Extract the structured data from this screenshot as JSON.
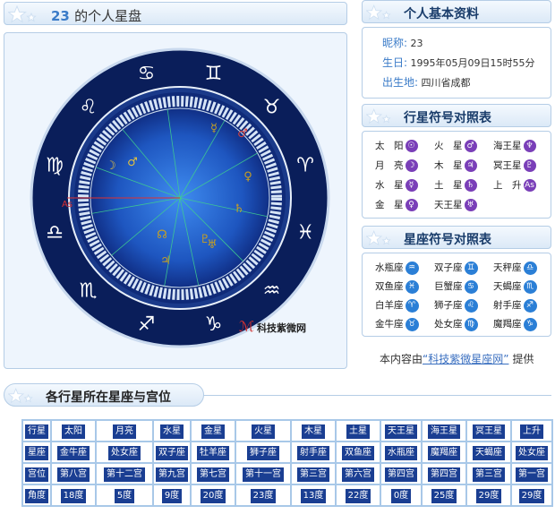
{
  "chart_header": {
    "number": "23",
    "title": "的个人星盘"
  },
  "profile_header": {
    "title": "个人基本资料"
  },
  "profile": {
    "nickname_label": "昵称:",
    "nickname": "23",
    "birthday_label": "生日:",
    "birthday": "1995年05月09日15时55分",
    "birthplace_label": "出生地:",
    "birthplace": "四川省成都"
  },
  "planet_legend_header": {
    "title": "行星符号对照表"
  },
  "planet_legend": [
    {
      "name": "太　阳",
      "glyph": "☉"
    },
    {
      "name": "火　星",
      "glyph": "♂"
    },
    {
      "name": "海王星",
      "glyph": "♆"
    },
    {
      "name": "月　亮",
      "glyph": "☽"
    },
    {
      "name": "木　星",
      "glyph": "♃"
    },
    {
      "name": "冥王星",
      "glyph": "♇"
    },
    {
      "name": "水　星",
      "glyph": "☿"
    },
    {
      "name": "土　星",
      "glyph": "♄"
    },
    {
      "name": "上　升",
      "glyph": "As"
    },
    {
      "name": "金　星",
      "glyph": "♀"
    },
    {
      "name": "天王星",
      "glyph": "♅"
    }
  ],
  "zodiac_legend_header": {
    "title": "星座符号对照表"
  },
  "zodiac_legend": [
    {
      "name": "水瓶座",
      "glyph": "♒"
    },
    {
      "name": "双子座",
      "glyph": "♊"
    },
    {
      "name": "天秤座",
      "glyph": "♎"
    },
    {
      "name": "双鱼座",
      "glyph": "♓"
    },
    {
      "name": "巨蟹座",
      "glyph": "♋"
    },
    {
      "name": "天蝎座",
      "glyph": "♏"
    },
    {
      "name": "白羊座",
      "glyph": "♈"
    },
    {
      "name": "狮子座",
      "glyph": "♌"
    },
    {
      "name": "射手座",
      "glyph": "♐"
    },
    {
      "name": "金牛座",
      "glyph": "♉"
    },
    {
      "name": "处女座",
      "glyph": "♍"
    },
    {
      "name": "魔羯座",
      "glyph": "♑"
    }
  ],
  "credit": {
    "prefix": "本内容由",
    "link": "“科技紫微星座网”",
    "suffix": "提供"
  },
  "watermark": "科技紫微网",
  "wheel_signs": [
    "♋",
    "♊",
    "♉",
    "♈",
    "♓",
    "♒",
    "♑",
    "♐",
    "♏",
    "♎",
    "♍",
    "♌"
  ],
  "wheel_planets": [
    {
      "glyph": "☿",
      "color": "#c8a020"
    },
    {
      "glyph": "♂",
      "color": "#d04040"
    },
    {
      "glyph": "☽",
      "color": "#e0c040"
    },
    {
      "glyph": "♂",
      "color": "#e0c040"
    },
    {
      "glyph": "♀",
      "color": "#c8a020"
    },
    {
      "glyph": "♄",
      "color": "#c8a020"
    },
    {
      "glyph": "☊",
      "color": "#c8a020"
    },
    {
      "glyph": "♇",
      "color": "#c8a020"
    },
    {
      "glyph": "♅",
      "color": "#c8a020"
    },
    {
      "glyph": "♃",
      "color": "#c8a020"
    },
    {
      "glyph": "As",
      "color": "#e03030"
    }
  ],
  "positions_header": {
    "title": "各行星所在星座与宫位"
  },
  "positions_table": {
    "rows": [
      [
        "行星",
        "太阳",
        "月亮",
        "水星",
        "金星",
        "火星",
        "木星",
        "土星",
        "天王星",
        "海王星",
        "冥王星",
        "上升"
      ],
      [
        "星座",
        "金牛座",
        "处女座",
        "双子座",
        "牡羊座",
        "狮子座",
        "射手座",
        "双鱼座",
        "水瓶座",
        "魔羯座",
        "天蝎座",
        "处女座"
      ],
      [
        "宫位",
        "第八宫",
        "第十二宫",
        "第九宫",
        "第七宫",
        "第十一宫",
        "第三宫",
        "第六宫",
        "第四宫",
        "第四宫",
        "第三宫",
        "第一宫"
      ],
      [
        "角度",
        "18度",
        "5度",
        "9度",
        "20度",
        "23度",
        "13度",
        "22度",
        "0度",
        "25度",
        "29度",
        "29度"
      ]
    ]
  },
  "colors": {
    "accent": "#3a7bc8",
    "wheel_dark": "#0a1e5a",
    "wheel_center": "#2a6fd8",
    "table_cell": "#1a3e92"
  }
}
